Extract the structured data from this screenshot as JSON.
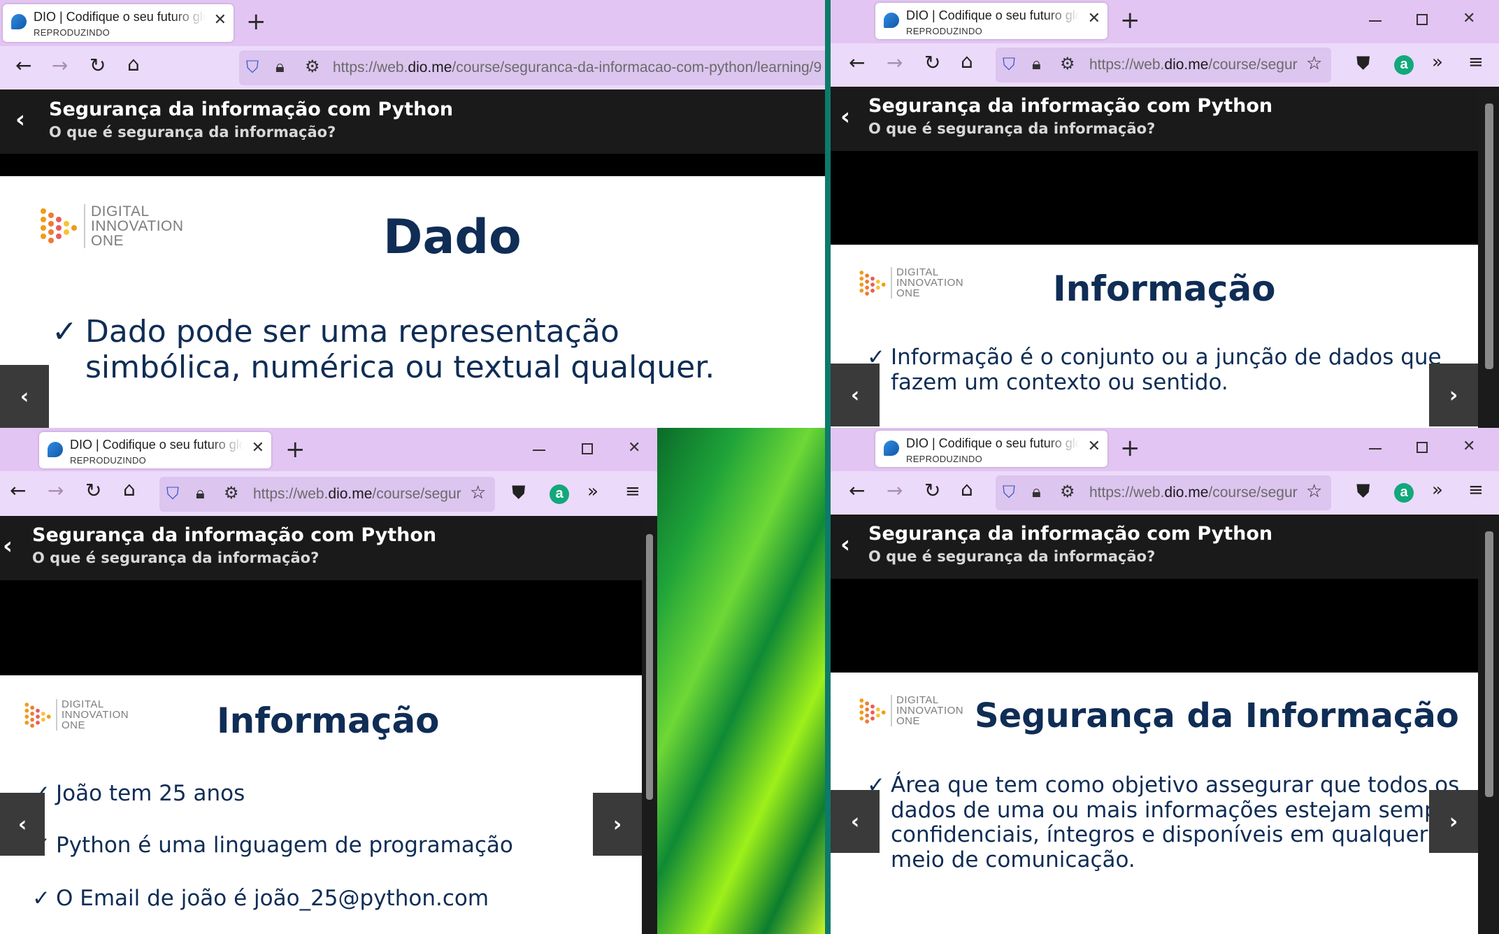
{
  "browser": {
    "tab_title": "DIO | Codifique o seu futuro global agora",
    "tab_subtitle": "REPRODUZINDO",
    "new_tab": "+",
    "url_full_prefix": "https://web.",
    "url_host": "dio.me",
    "url_path_full": "/course/seguranca-da-informacao-com-python/learning/9",
    "url_path_short": "/course/segur",
    "icons": [
      "back-icon",
      "forward-icon",
      "reload-icon",
      "home-icon",
      "shield-icon",
      "lock-icon",
      "permissions-icon",
      "bookmark-star-icon",
      "pocket-icon",
      "extension-icon",
      "overflow-icon",
      "menu-icon"
    ]
  },
  "course": {
    "title": "Segurança da informação com Python",
    "lesson": "O que é segurança da informação?"
  },
  "logo": {
    "line1": "DIGITAL",
    "line2": "INNOVATION",
    "line3": "ONE"
  },
  "slides": {
    "dado": {
      "title": "Dado",
      "bullets": [
        "Dado pode ser uma representação simbólica, numérica ou textual qualquer."
      ]
    },
    "informacao_def": {
      "title": "Informação",
      "bullets": [
        "Informação é o conjunto ou a junção de dados que fazem um contexto ou sentido."
      ]
    },
    "informacao_ex": {
      "title": "Informação",
      "bullets": [
        "João tem 25 anos",
        "Python é uma linguagem de programação",
        "O Email de joão é joão_25@python.com"
      ]
    },
    "seguranca": {
      "title": "Segurança da Informação",
      "bullets": [
        "Área que tem como objetivo assegurar que todos os dados de uma ou mais informações estejam sempre confidenciais, íntegros e disponíveis em qualquer meio de comunicação."
      ]
    }
  },
  "colors": {
    "tabbar": "#e3c5f3",
    "navbar": "#ecdafa",
    "slide_title": "#0f2d55",
    "header_bg": "#1a1a1a"
  }
}
